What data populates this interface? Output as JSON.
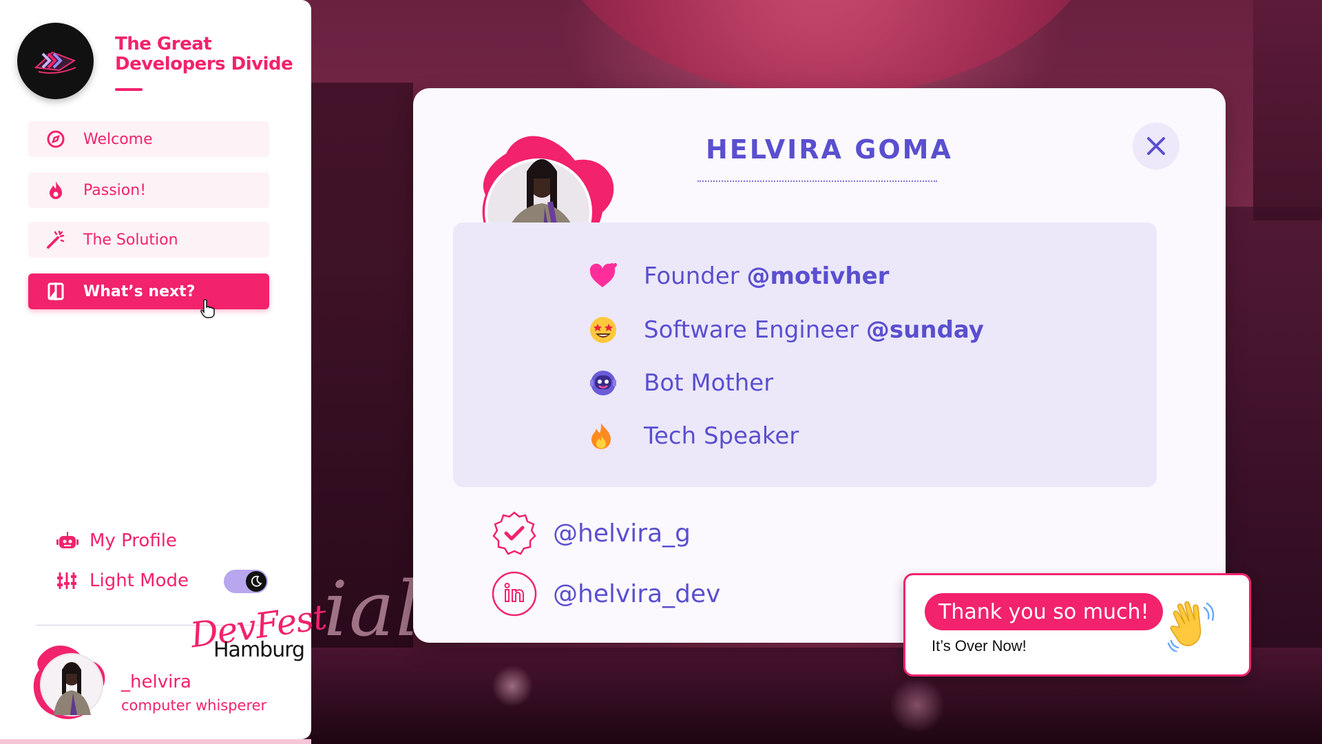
{
  "app": {
    "brand_title": "The Great Developers Divide",
    "accent_color": "#f2226d",
    "secondary_color": "#5a4fcf"
  },
  "sidebar": {
    "items": [
      {
        "label": "Welcome",
        "icon": "compass-icon",
        "active": false
      },
      {
        "label": "Passion!",
        "icon": "flame-icon",
        "active": false
      },
      {
        "label": "The Solution",
        "icon": "magic-wand-icon",
        "active": false
      },
      {
        "label": "What’s next?",
        "icon": "split-screen-icon",
        "active": true
      }
    ],
    "profile_label": "My Profile",
    "theme_label": "Light Mode",
    "theme_toggle_icon": "moon-icon",
    "event_script": "DevFest",
    "event_city": "Hamburg",
    "user_name": "_helvira",
    "user_tagline": "computer whisperer"
  },
  "card": {
    "name": "HELVIRA GOMA",
    "roles": [
      {
        "emoji": "heart-icon",
        "prefix": "Founder ",
        "handle": "@motivher"
      },
      {
        "emoji": "star-struck-icon",
        "prefix": "Software Engineer ",
        "handle": "@sunday"
      },
      {
        "emoji": "robot-icon",
        "prefix": "Bot Mother",
        "handle": ""
      },
      {
        "emoji": "fire-icon",
        "prefix": "Tech Speaker",
        "handle": ""
      }
    ],
    "socials": [
      {
        "icon": "verified-badge-icon",
        "handle": "@helvira_g"
      },
      {
        "icon": "linkedin-icon",
        "handle": "@helvira_dev"
      }
    ]
  },
  "toast": {
    "title": "Thank you so much!",
    "subtitle": "It’s Over Now!",
    "icon": "waving-hand-icon"
  }
}
